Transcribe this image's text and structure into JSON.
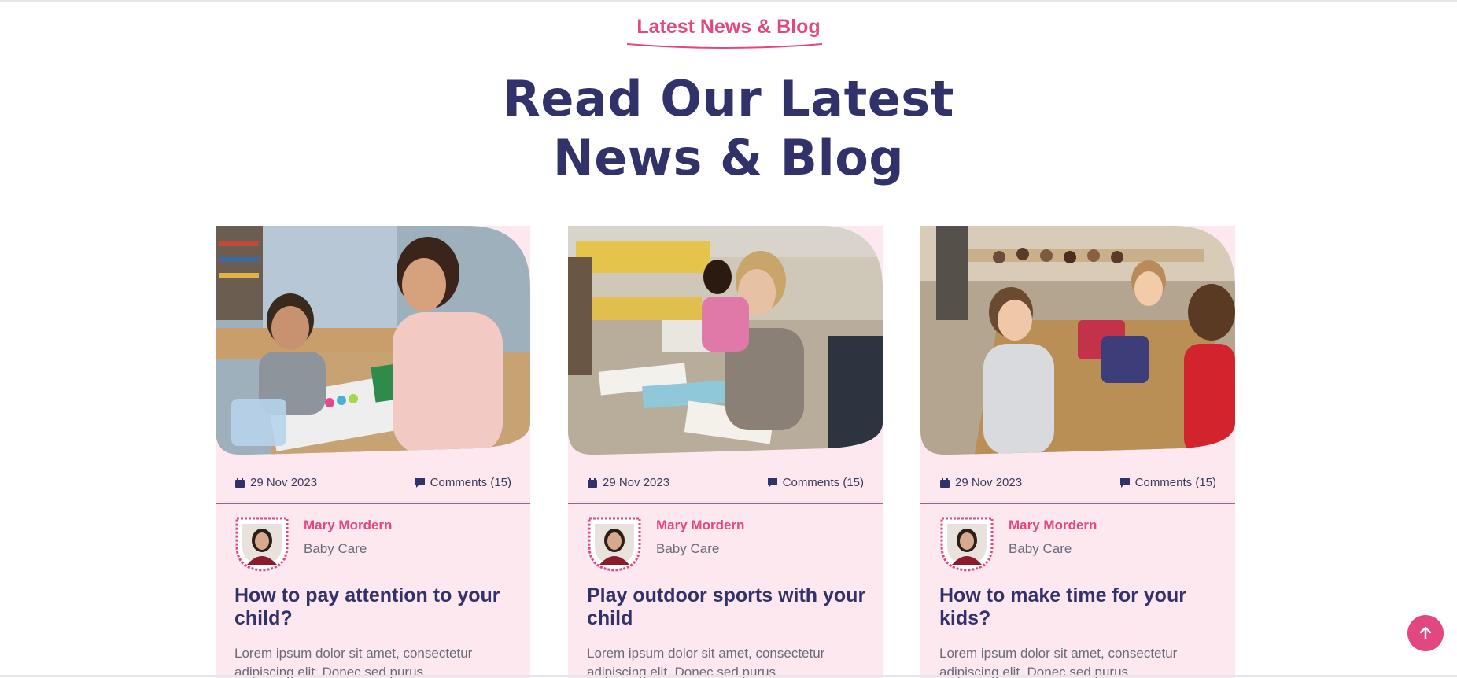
{
  "section": {
    "tag": "Latest News & Blog",
    "heading_line1": "Read Our Latest",
    "heading_line2": "News & Blog"
  },
  "colors": {
    "accent": "#e2487f",
    "heading": "#32326b",
    "card_bg": "#fde8ef"
  },
  "posts": [
    {
      "date": "29 Nov 2023",
      "comments": "Comments (15)",
      "author": "Mary Mordern",
      "role": "Baby Care",
      "title": "How to pay attention to your child?",
      "excerpt": "Lorem ipsum dolor sit amet, consectetur adipiscing elit. Donec sed purus"
    },
    {
      "date": "29 Nov 2023",
      "comments": "Comments (15)",
      "author": "Mary Mordern",
      "role": "Baby Care",
      "title": "Play outdoor sports with your child",
      "excerpt": "Lorem ipsum dolor sit amet, consectetur adipiscing elit. Donec sed purus"
    },
    {
      "date": "29 Nov 2023",
      "comments": "Comments (15)",
      "author": "Mary Mordern",
      "role": "Baby Care",
      "title": "How to make time for your kids?",
      "excerpt": "Lorem ipsum dolor sit amet, consectetur adipiscing elit. Donec sed purus"
    }
  ],
  "icons": {
    "date": "calendar-icon",
    "comments": "comment-icon",
    "scroll_top": "arrow-up-icon"
  }
}
